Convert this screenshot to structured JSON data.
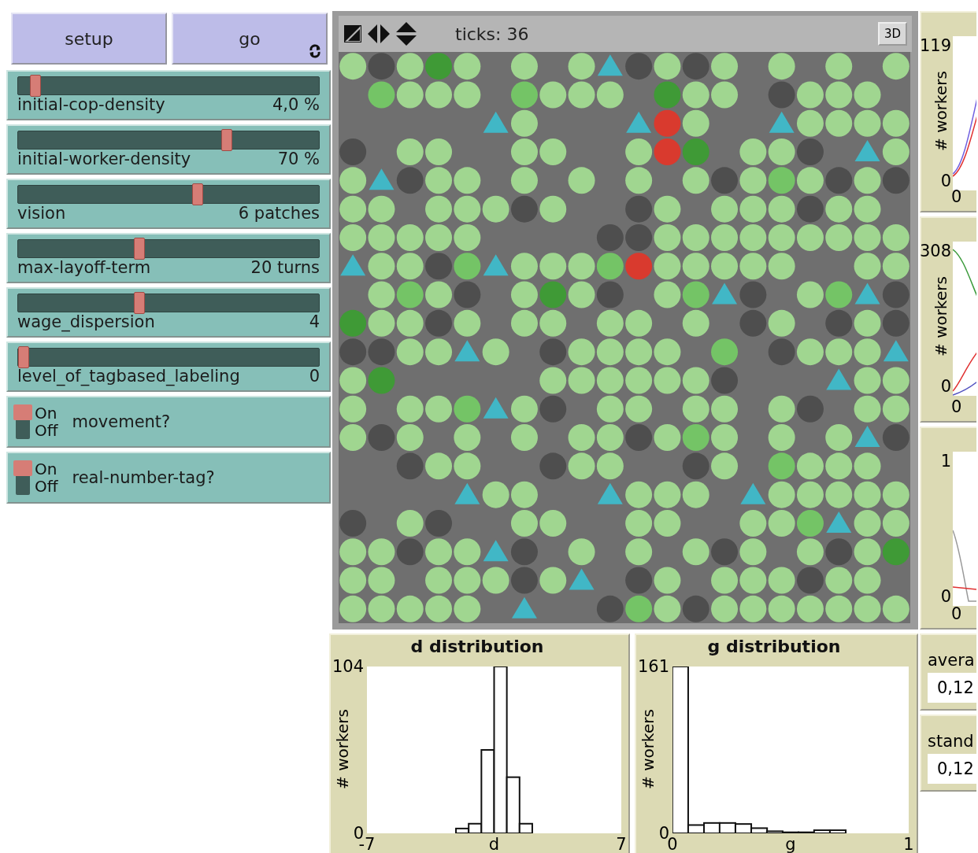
{
  "buttons": [
    {
      "label": "setup",
      "forever": false
    },
    {
      "label": "go",
      "forever": true
    }
  ],
  "sliders": [
    {
      "name": "initial-cop-density",
      "value": "4,0 %",
      "level": 0.04
    },
    {
      "name": "initial-worker-density",
      "value": "70 %",
      "level": 0.7
    },
    {
      "name": "vision",
      "value": "6 patches",
      "level": 0.6
    },
    {
      "name": "max-layoff-term",
      "value": "20 turns",
      "level": 0.4
    },
    {
      "name": "wage_dispersion",
      "value": "4",
      "level": 0.4
    },
    {
      "name": "level_of_tagbased_labeling",
      "value": "0",
      "level": 0
    }
  ],
  "switches": [
    {
      "label": "movement?",
      "on": true,
      "on_text": "On",
      "off_text": "Off"
    },
    {
      "label": "real-number-tag?",
      "on": true,
      "on_text": "On",
      "off_text": "Off"
    }
  ],
  "view": {
    "ticks": "ticks: 36",
    "button_3d": "3D"
  },
  "histograms": [
    {
      "chart_data": {
        "type": "bar",
        "title": "d distribution",
        "xlabel": "d",
        "ylabel": "# workers",
        "x": [
          -1.75,
          -1.05,
          -0.35,
          0.35,
          1.05,
          1.75
        ],
        "values": [
          3,
          6,
          52,
          104,
          35,
          6
        ],
        "xlim": [
          -7,
          7
        ],
        "ylim": [
          0,
          104
        ],
        "xticks": [
          -7,
          7
        ],
        "yticks": [
          0,
          104
        ]
      }
    },
    {
      "chart_data": {
        "type": "bar",
        "title": "g distribution",
        "xlabel": "g",
        "ylabel": "# workers",
        "x": [
          0.033,
          0.1,
          0.167,
          0.233,
          0.3,
          0.367,
          0.433,
          0.5,
          0.567,
          0.633,
          0.7
        ],
        "values": [
          161,
          8,
          10,
          10,
          9,
          5,
          2,
          1,
          1,
          3,
          3
        ],
        "xlim": [
          0,
          1
        ],
        "ylim": [
          0,
          161
        ],
        "xticks": [
          0,
          1
        ],
        "yticks": [
          0,
          161
        ]
      }
    }
  ],
  "plots": [
    {
      "y_max": "119",
      "y_min": "0",
      "x_min": "0",
      "ylabel": "# workers"
    },
    {
      "y_max": "308",
      "y_min": "0",
      "x_min": "0",
      "ylabel": "# workers"
    },
    {
      "y_max": "1",
      "y_min": "0",
      "x_min": "0"
    }
  ],
  "monitors": [
    {
      "label": "avera",
      "value": "0,12"
    },
    {
      "label": "stand",
      "value": "0,12"
    }
  ]
}
